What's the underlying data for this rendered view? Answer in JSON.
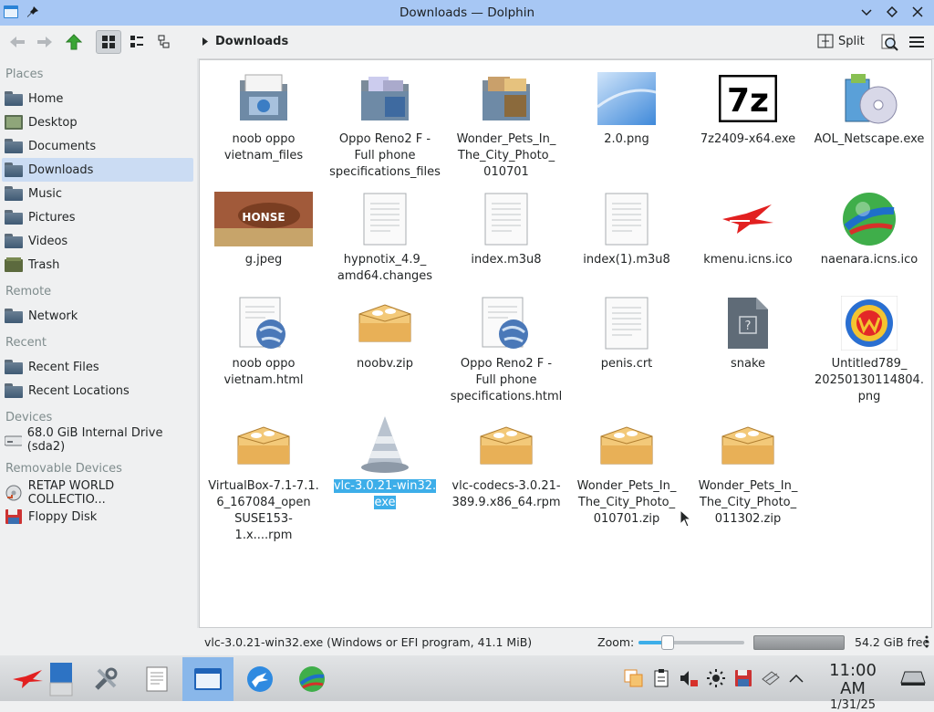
{
  "window": {
    "title": "Downloads — Dolphin"
  },
  "toolbar": {
    "breadcrumb": "Downloads",
    "split_label": "Split"
  },
  "sidebar": {
    "sections": [
      "Places",
      "Remote",
      "Recent",
      "Devices",
      "Removable Devices"
    ],
    "places": [
      "Home",
      "Desktop",
      "Documents",
      "Downloads",
      "Music",
      "Pictures",
      "Videos",
      "Trash"
    ],
    "remote": [
      "Network"
    ],
    "recent": [
      "Recent Files",
      "Recent Locations"
    ],
    "devices": [
      "68.0 GiB Internal Drive (sda2)"
    ],
    "removable": [
      "RETAP WORLD COLLECTIO...",
      "Floppy Disk"
    ],
    "selected": "Downloads"
  },
  "files": [
    {
      "name": "noob oppo vietnam_files",
      "icon": "html-folder-icon"
    },
    {
      "name": "Oppo Reno2 F - Full phone specifications_files",
      "icon": "images-folder-icon"
    },
    {
      "name": "Wonder_Pets_In_ The_City_Photo_ 010701",
      "icon": "images-folder-icon"
    },
    {
      "name": "2.0.png",
      "icon": "image-thumbnail"
    },
    {
      "name": "7z2409-x64.exe",
      "icon": "7zip-icon"
    },
    {
      "name": "AOL_Netscape.exe",
      "icon": "installer-icon"
    },
    {
      "name": "g.jpeg",
      "icon": "horse-thumbnail",
      "thumb_text": "HONSE"
    },
    {
      "name": "hypnotix_4.9_ amd64.changes",
      "icon": "text-file-icon"
    },
    {
      "name": "index.m3u8",
      "icon": "text-file-icon"
    },
    {
      "name": "index(1).m3u8",
      "icon": "text-file-icon"
    },
    {
      "name": "kmenu.icns.ico",
      "icon": "kmenu-icon"
    },
    {
      "name": "naenara.icns.ico",
      "icon": "globe-icon"
    },
    {
      "name": "noob oppo vietnam.html",
      "icon": "html-file-icon"
    },
    {
      "name": "noobv.zip",
      "icon": "package-icon"
    },
    {
      "name": "Oppo Reno2 F - Full phone specifications.html",
      "icon": "html-file-icon"
    },
    {
      "name": "penis.crt",
      "icon": "text-file-icon"
    },
    {
      "name": "snake",
      "icon": "unknown-file-icon"
    },
    {
      "name": "Untitled789_ 20250130114804. png",
      "icon": "w-logo-thumbnail"
    },
    {
      "name": "VirtualBox-7.1-7.1. 6_167084_open SUSE153-1.x....rpm",
      "icon": "package-icon"
    },
    {
      "name": "vlc-3.0.21-win32. exe",
      "icon": "vlc-cone-icon",
      "selected": true
    },
    {
      "name": "vlc-codecs-3.0.21- 389.9.x86_64.rpm",
      "icon": "package-icon"
    },
    {
      "name": "Wonder_Pets_In_ The_City_Photo_ 010701.zip",
      "icon": "package-icon"
    },
    {
      "name": "Wonder_Pets_In_ The_City_Photo_ 011302.zip",
      "icon": "package-icon"
    }
  ],
  "status": {
    "text": "vlc-3.0.21-win32.exe (Windows or EFI program, 41.1 MiB)",
    "zoom_label": "Zoom:",
    "zoom_level": 0.27,
    "free_label": "54.2 GiB free"
  },
  "taskbar": {
    "clock_time": "11:00 AM",
    "clock_date": "1/31/25"
  },
  "colors": {
    "titlebar": "#a7c7f4",
    "selection": "#3daee9",
    "sidebar_selection": "#cbdcf3"
  }
}
